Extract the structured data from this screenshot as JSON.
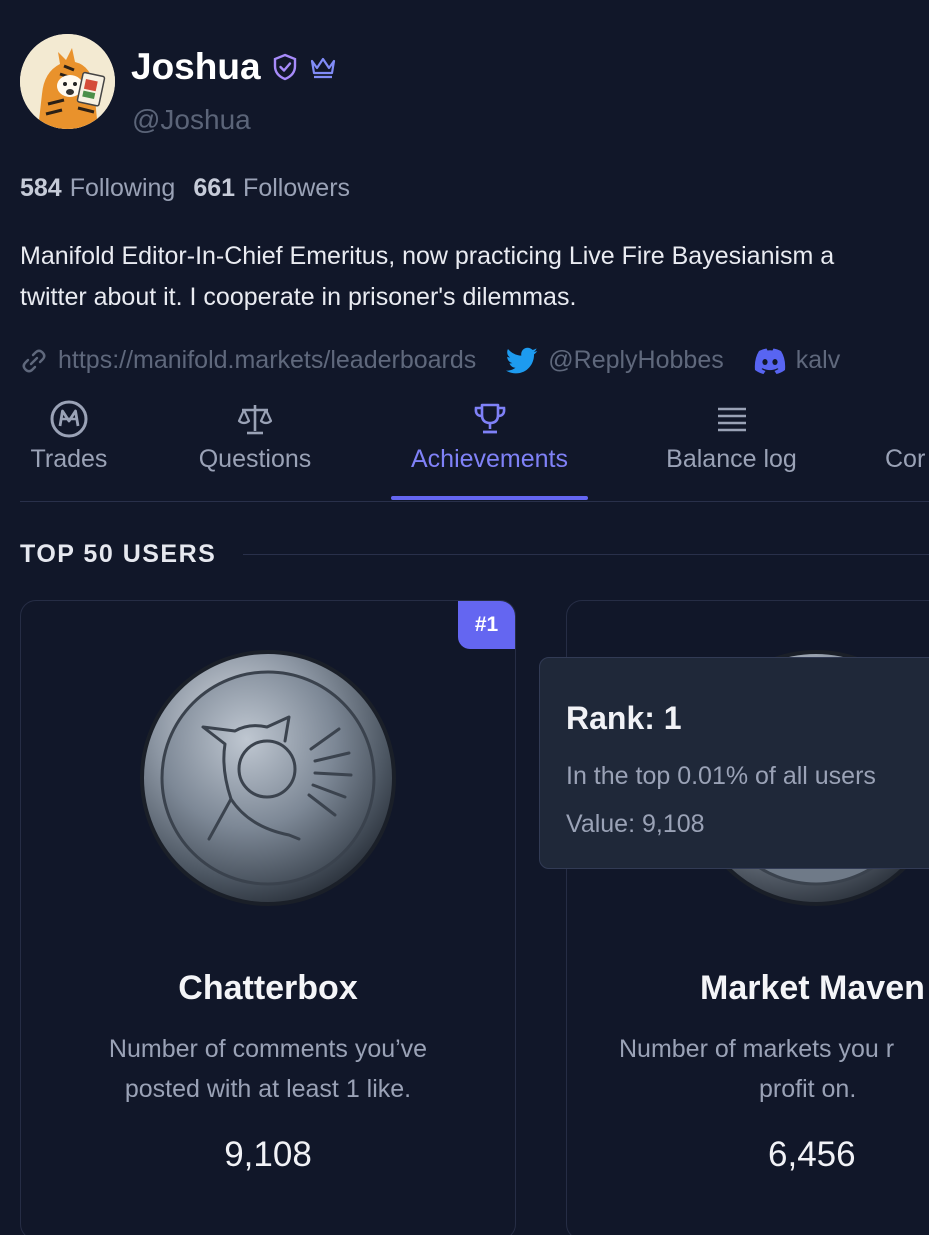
{
  "profile": {
    "name": "Joshua",
    "handle": "@Joshua",
    "following_count": "584",
    "following_label": "Following",
    "followers_count": "661",
    "followers_label": "Followers",
    "bio_line1": "Manifold Editor-In-Chief Emeritus, now practicing Live Fire Bayesianism a",
    "bio_line2": "twitter about it. I cooperate in prisoner's dilemmas.",
    "website": "https://manifold.markets/leaderboards",
    "twitter": "@ReplyHobbes",
    "discord": "kalv"
  },
  "tabs": [
    {
      "label": "Trades",
      "icon": "mana-coin-icon"
    },
    {
      "label": "Questions",
      "icon": "scale-icon"
    },
    {
      "label": "Achievements",
      "icon": "trophy-icon",
      "active": true
    },
    {
      "label": "Balance log",
      "icon": "list-icon"
    },
    {
      "label": "Cor",
      "icon": "comments-icon"
    }
  ],
  "section": {
    "title": "TOP 50 USERS"
  },
  "cards": [
    {
      "rank_tag": "#1",
      "title": "Chatterbox",
      "desc_line1": "Number of comments you’ve",
      "desc_line2": "posted with at least 1 like.",
      "value": "9,108"
    },
    {
      "title": "Market Maven",
      "desc_line1": "Number of markets you r",
      "desc_line2": "profit on.",
      "value": "6,456"
    }
  ],
  "tooltip": {
    "title": "Rank: 1",
    "line1": "In the top 0.01% of all users",
    "line2": "Value: 9,108"
  },
  "colors": {
    "background": "#111729",
    "accent": "#6466f1",
    "twitter": "#1d9bf0",
    "discord": "#5865f2"
  }
}
